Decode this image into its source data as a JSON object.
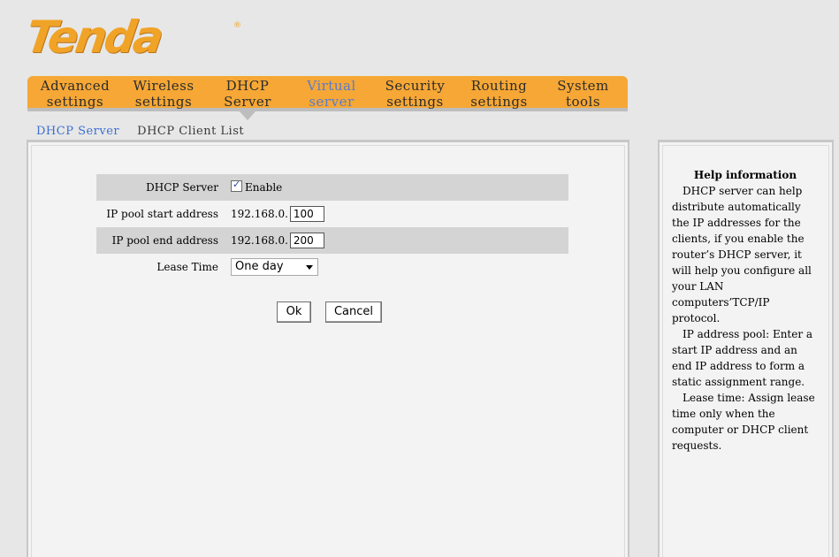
{
  "logo": {
    "text": "Tenda",
    "reg": "®"
  },
  "nav": {
    "items": [
      {
        "line1": "Advanced",
        "line2": "settings"
      },
      {
        "line1": "Wireless",
        "line2": "settings"
      },
      {
        "line1": "DHCP",
        "line2": "Server"
      },
      {
        "line1": "Virtual",
        "line2": "server"
      },
      {
        "line1": "Security",
        "line2": "settings"
      },
      {
        "line1": "Routing",
        "line2": "settings"
      },
      {
        "line1": "System",
        "line2": "tools"
      }
    ]
  },
  "subnav": {
    "server": "DHCP Server",
    "client_list": "DHCP Client List"
  },
  "form": {
    "dhcp_server_label": "DHCP Server",
    "enable_label": "Enable",
    "start_label": "IP pool start address",
    "start_prefix": "192.168.0.",
    "start_value": "100",
    "end_label": "IP pool end address",
    "end_prefix": "192.168.0.",
    "end_value": "200",
    "lease_label": "Lease Time",
    "lease_value": "One day"
  },
  "buttons": {
    "ok": "Ok",
    "cancel": "Cancel"
  },
  "help": {
    "title": "Help information",
    "p1": "DHCP server can help distribute automatically the IP addresses for the clients, if you enable the router’s DHCP server, it will help you configure all your LAN computers’TCP/IP protocol.",
    "p2": "IP address pool: Enter a start IP address and an end IP address to form a static assignment range.",
    "p3": "Lease time: Assign lease time only when the computer or DHCP client requests."
  },
  "colors": {
    "nav_bg": "#f6a735",
    "nav_active": "#5b7cc9",
    "logo": "#f0a327",
    "subnav_active": "#3d6fd1"
  }
}
